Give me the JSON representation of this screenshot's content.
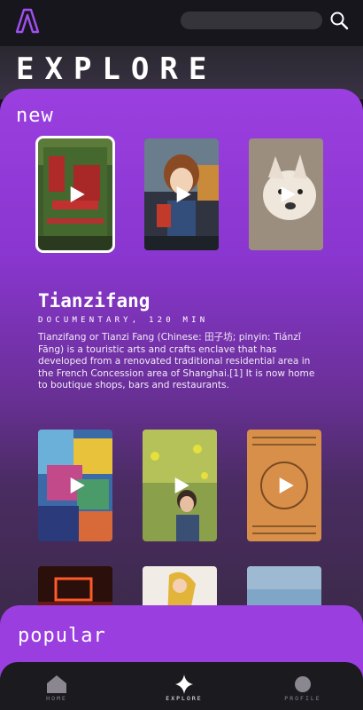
{
  "header": {
    "logo_icon": "letter-a-logo-icon",
    "search_icon": "search-icon",
    "title": "EXPLORE"
  },
  "sections": {
    "new_label": "new",
    "popular_label": "popular"
  },
  "detail": {
    "title": "Tianzifang",
    "meta": "DOCUMENTARY, 120 MIN",
    "description": "Tianzifang or Tianzi Fang (Chinese: 田子坊; pinyin: Tiánzǐ Fāng) is a touristic arts and crafts enclave that has developed from a renovated traditional residential area in the French Concession area of Shanghai.[1] It is now home to boutique shops, bars and restaurants."
  },
  "new_items": [
    {
      "name": "tianzifang-gate",
      "selected": true
    },
    {
      "name": "anime-girl"
    },
    {
      "name": "french-bulldog"
    }
  ],
  "grid_items": [
    {
      "name": "abstract-portrait"
    },
    {
      "name": "child-in-flower-field"
    },
    {
      "name": "text-poster"
    }
  ],
  "peek_items": [
    {
      "name": "neon-sign"
    },
    {
      "name": "illustration"
    },
    {
      "name": "sky"
    }
  ],
  "nav": [
    {
      "label": "HOME",
      "icon": "home-icon",
      "active": false
    },
    {
      "label": "EXPLORE",
      "icon": "sparkle-icon",
      "active": true
    },
    {
      "label": "PROFILE",
      "icon": "profile-circle-icon",
      "active": false
    }
  ],
  "colors": {
    "accent": "#9b3fe0",
    "logo": "#a24ff0",
    "background": "#141218"
  }
}
